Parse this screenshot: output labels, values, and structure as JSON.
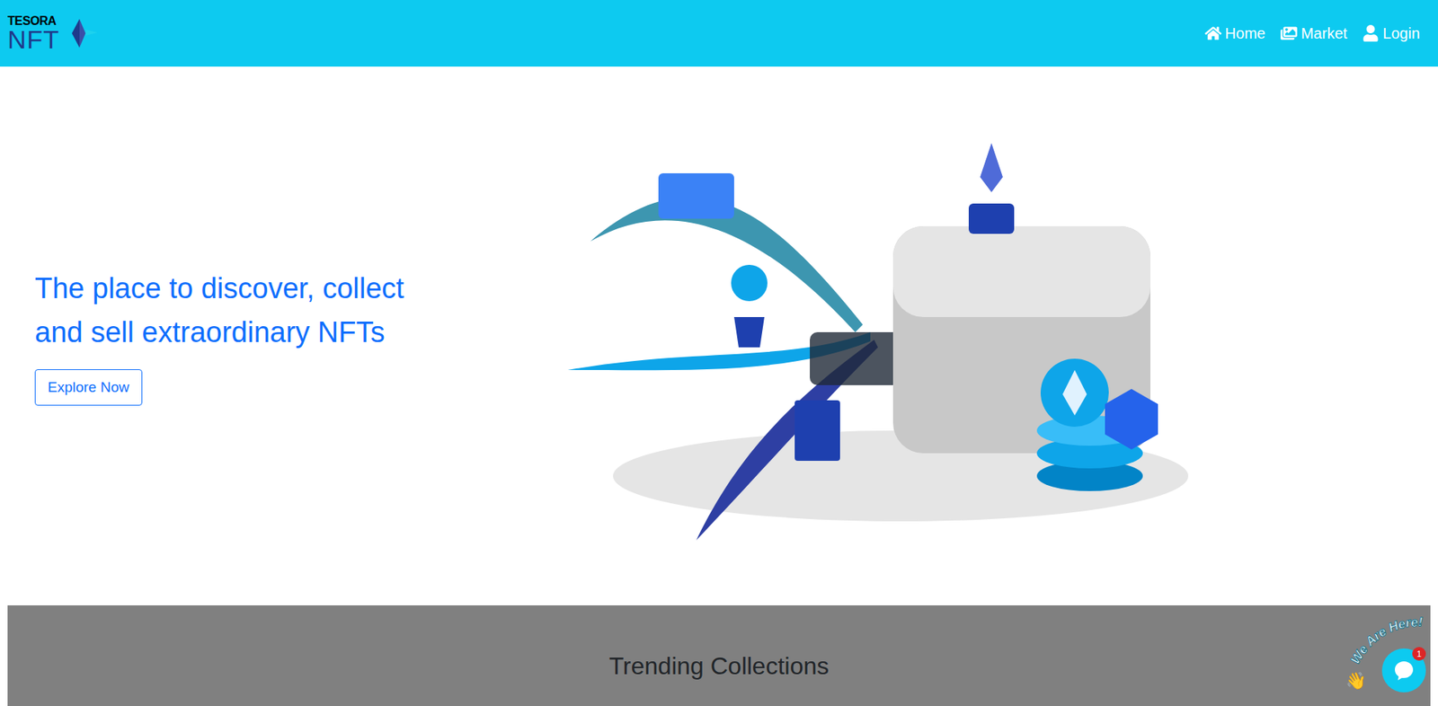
{
  "navbar": {
    "logo": {
      "top": "TESORA",
      "bottom": "NFT"
    },
    "items": [
      {
        "label": "Home",
        "icon": "home"
      },
      {
        "label": "Market",
        "icon": "market"
      },
      {
        "label": "Login",
        "icon": "user"
      }
    ]
  },
  "hero": {
    "heading_lines": [
      "The place to discover, collect",
      "and sell extraordinary NFTs"
    ],
    "button": "Explore Now"
  },
  "trending": {
    "title": "Trending Collections"
  },
  "chat_widget": {
    "caption": "We Are Here!",
    "emoji": "👋",
    "badge": "1"
  }
}
